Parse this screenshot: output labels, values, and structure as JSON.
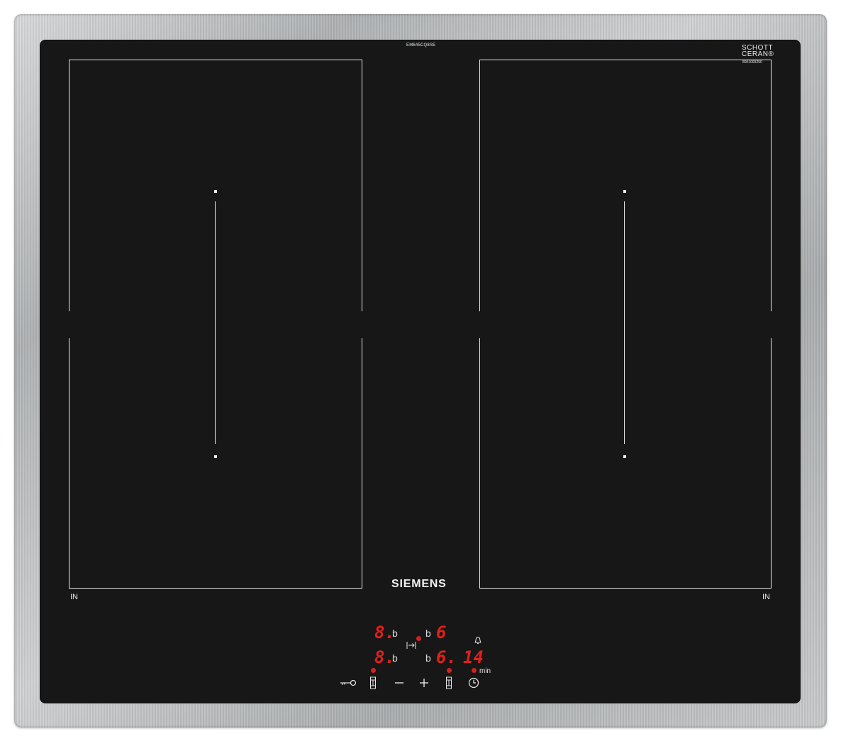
{
  "appliance": {
    "model_code": "EM645CQ8SE",
    "glass_brand_line1": "SCHOTT",
    "glass_brand_line2": "CERAN®",
    "glass_serial": "8001093250",
    "brand": "SIEMENS",
    "zone_left_label": "IN",
    "zone_right_label": "IN"
  },
  "control_panel": {
    "rear_left_level": "8.",
    "rear_left_booster": "b",
    "rear_right_booster": "b",
    "rear_right_level": "6",
    "front_left_level": "8.",
    "front_left_booster": "b",
    "front_right_booster": "b",
    "front_right_level": "6.",
    "timer_value": "14",
    "timer_unit": "min",
    "icons": {
      "bell": "bell-icon",
      "transfer": "move-transfer-icon",
      "key": "child-lock-key-icon",
      "zone_select_left": "zone-select-icon",
      "minus": "minus-icon",
      "plus": "plus-icon",
      "zone_select_right": "zone-select-icon",
      "clock": "clock-timer-icon"
    },
    "display_color": "#e0201c"
  },
  "colors": {
    "glass": "#161716",
    "frame": "#b9bcbe",
    "markings": "#e6e6e6"
  }
}
